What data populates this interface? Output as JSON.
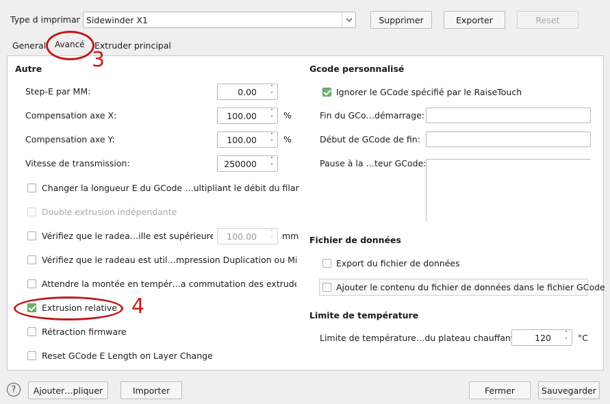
{
  "top": {
    "printer_type_label": "Type d imprimant",
    "printer_value": "Sidewinder X1",
    "delete_label": "Supprimer",
    "export_label": "Exporter",
    "reset_label": "Reset"
  },
  "tabs": [
    "General",
    "Avancé",
    "Extruder principal"
  ],
  "annotations": {
    "tab_marker": "3",
    "checkbox_marker": "4"
  },
  "autre": {
    "title": "Autre",
    "fields": [
      {
        "label": "Step-E par MM:",
        "value": "0.00",
        "unit": ""
      },
      {
        "label": "Compensation axe X:",
        "value": "100.00",
        "unit": "%"
      },
      {
        "label": "Compensation axe Y:",
        "value": "100.00",
        "unit": "%"
      },
      {
        "label": "Vitesse de transmission:",
        "value": "250000",
        "unit": ""
      }
    ],
    "checkboxes": [
      {
        "label": "Changer la longueur E du GCode …ultipliant le débit du filament"
      },
      {
        "label": "Double extrusion indépendante"
      },
      {
        "label": "Vérifiez que le radea…ille est supérieure à"
      },
      {
        "label": "Vérifiez que le radeau est util…mpression Duplication ou Miroir"
      },
      {
        "label": "Attendre la montée en tempér…a commutation des extrudeurs"
      },
      {
        "label": "Extrusion relative"
      },
      {
        "label": "Rétraction firmware"
      },
      {
        "label": "Reset GCode E Length on Layer Change"
      }
    ],
    "raft_value": "100.00",
    "raft_unit": "mm"
  },
  "gcode": {
    "title": "Gcode personnalisé",
    "ignore_label": "Ignorer le GCode spécifié par le RaiseTouch",
    "end_start_label": "Fin du GCo…démarrage:",
    "start_end_label": "Début de GCode de fin:",
    "pause_label": "Pause à la …teur GCode:"
  },
  "datafile": {
    "title": "Fichier de données",
    "export_label": "Export du fichier de données",
    "add_label": "Ajouter le contenu du fichier de données dans le fichier GCode"
  },
  "temp": {
    "title": "Limite de température",
    "label": "Limite de température…du plateau chauffant:",
    "value": "120",
    "unit": "°C"
  },
  "bottom": {
    "help": "?",
    "apply_label": "Ajouter…pliquer",
    "import_label": "Importer",
    "close_label": "Fermer",
    "save_label": "Sauvegarder"
  }
}
